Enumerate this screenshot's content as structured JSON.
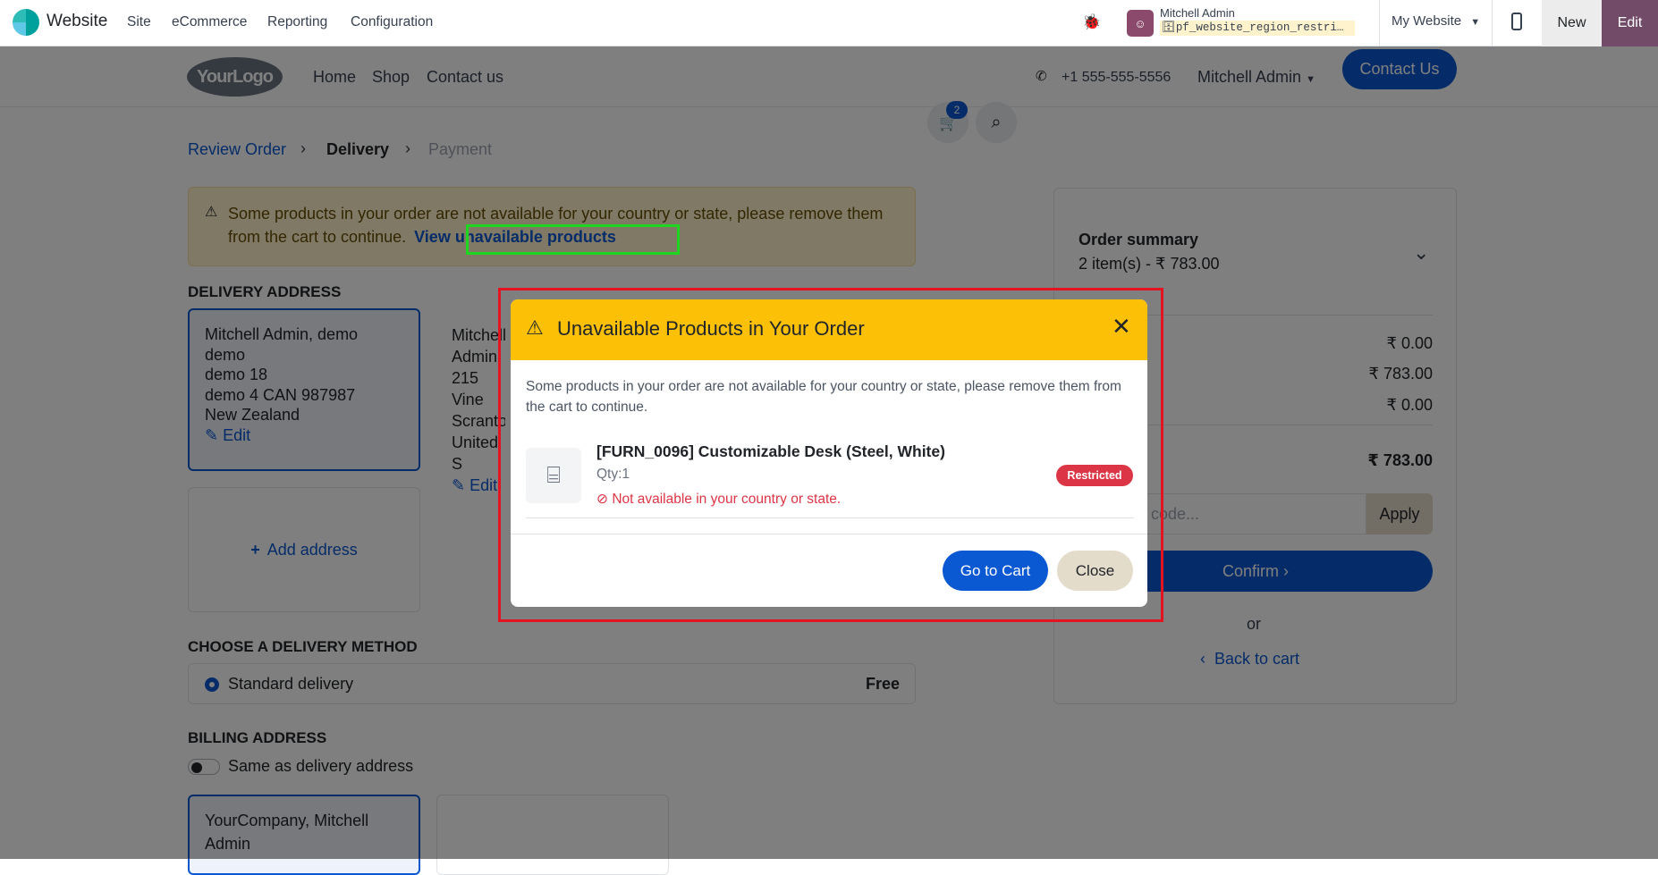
{
  "topbar": {
    "app_name": "Website",
    "menu": [
      "Site",
      "eCommerce",
      "Reporting",
      "Configuration"
    ],
    "user_name": "Mitchell Admin",
    "db_name": "pf_website_region_restri…",
    "website_select": "My Website",
    "new_label": "New",
    "edit_label": "Edit"
  },
  "navbar": {
    "logo_text": "YourLogo",
    "links": [
      "Home",
      "Shop",
      "Contact us"
    ],
    "cart_count": "2",
    "phone": "+1 555-555-5556",
    "user": "Mitchell Admin",
    "contact_button": "Contact Us"
  },
  "breadcrumb": {
    "step1": "Review Order",
    "step2": "Delivery",
    "step3": "Payment"
  },
  "alert": {
    "text": "Some products in your order are not available for your country or state, please remove them from the cart to continue.",
    "link": "View unavailable products"
  },
  "delivery": {
    "heading": "DELIVERY ADDRESS",
    "address1": [
      "Mitchell Admin, demo",
      "demo",
      "demo 18",
      "demo 4 CAN 987987",
      "New Zealand"
    ],
    "address2": [
      "Mitchell",
      "Admin",
      "215 Vine",
      "Scranton",
      "United S"
    ],
    "edit_label": "Edit",
    "add_address": "Add address"
  },
  "method": {
    "heading": "CHOOSE A DELIVERY METHOD",
    "name": "Standard delivery",
    "price": "Free"
  },
  "billing": {
    "heading": "BILLING ADDRESS",
    "same_as": "Same as delivery address",
    "address": [
      "YourCompany, Mitchell",
      "Admin"
    ]
  },
  "summary": {
    "title": "Order summary",
    "subtitle": "2 item(s) -  ₹ 783.00",
    "row1": "₹ 0.00",
    "row2": "₹ 783.00",
    "row3": "₹ 0.00",
    "total": "₹ 783.00",
    "discount_placeholder": "t code...",
    "apply": "Apply",
    "confirm": "Confirm",
    "or": "or",
    "back": "Back to cart"
  },
  "modal": {
    "title": "Unavailable Products in Your Order",
    "message": "Some products in your order are not available for your country or state, please remove them from the cart to continue.",
    "product_name": "[FURN_0096] Customizable Desk (Steel, White)",
    "qty": "Qty:1",
    "error": "Not available in your country or state.",
    "badge": "Restricted",
    "go_to_cart": "Go to Cart",
    "close": "Close"
  },
  "colors": {
    "primary": "#0b59d2",
    "warning": "#fcc107",
    "danger": "#dc3545",
    "odoo_purple": "#714b67",
    "highlight_red": "#e3141f",
    "highlight_green": "#1fd51f"
  }
}
